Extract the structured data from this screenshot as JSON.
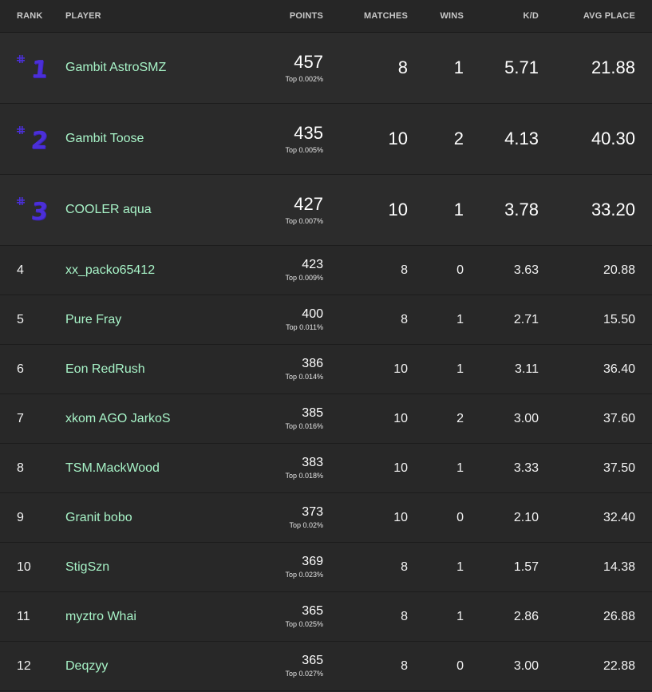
{
  "columns": {
    "rank": "RANK",
    "player": "PLAYER",
    "points": "POINTS",
    "matches": "MATCHES",
    "wins": "WINS",
    "kd": "K/D",
    "avg_place": "AVG PLACE"
  },
  "colors": {
    "player_name": "#a7f3c7",
    "rank_badge": "#4b2fd8",
    "background": "#282828"
  },
  "icons": {
    "rank_badge": "hash-icon"
  },
  "rows": [
    {
      "rank": "1",
      "player": "Gambit AstroSMZ",
      "points": "457",
      "top": "Top 0.002%",
      "matches": "8",
      "wins": "1",
      "kd": "5.71",
      "avg": "21.88"
    },
    {
      "rank": "2",
      "player": "Gambit Toose",
      "points": "435",
      "top": "Top 0.005%",
      "matches": "10",
      "wins": "2",
      "kd": "4.13",
      "avg": "40.30"
    },
    {
      "rank": "3",
      "player": "COOLER aqua",
      "points": "427",
      "top": "Top 0.007%",
      "matches": "10",
      "wins": "1",
      "kd": "3.78",
      "avg": "33.20"
    },
    {
      "rank": "4",
      "player": "xx_packo65412",
      "points": "423",
      "top": "Top 0.009%",
      "matches": "8",
      "wins": "0",
      "kd": "3.63",
      "avg": "20.88"
    },
    {
      "rank": "5",
      "player": "Pure Fray",
      "points": "400",
      "top": "Top 0.011%",
      "matches": "8",
      "wins": "1",
      "kd": "2.71",
      "avg": "15.50"
    },
    {
      "rank": "6",
      "player": "Eon RedRush",
      "points": "386",
      "top": "Top 0.014%",
      "matches": "10",
      "wins": "1",
      "kd": "3.11",
      "avg": "36.40"
    },
    {
      "rank": "7",
      "player": "xkom AGO JarkoS",
      "points": "385",
      "top": "Top 0.016%",
      "matches": "10",
      "wins": "2",
      "kd": "3.00",
      "avg": "37.60"
    },
    {
      "rank": "8",
      "player": "TSM.MackWood",
      "points": "383",
      "top": "Top 0.018%",
      "matches": "10",
      "wins": "1",
      "kd": "3.33",
      "avg": "37.50"
    },
    {
      "rank": "9",
      "player": "Granit bobo",
      "points": "373",
      "top": "Top 0.02%",
      "matches": "10",
      "wins": "0",
      "kd": "2.10",
      "avg": "32.40"
    },
    {
      "rank": "10",
      "player": "StigSzn",
      "points": "369",
      "top": "Top 0.023%",
      "matches": "8",
      "wins": "1",
      "kd": "1.57",
      "avg": "14.38"
    },
    {
      "rank": "11",
      "player": "myztro Whai",
      "points": "365",
      "top": "Top 0.025%",
      "matches": "8",
      "wins": "1",
      "kd": "2.86",
      "avg": "26.88"
    },
    {
      "rank": "12",
      "player": "Deqzyy",
      "points": "365",
      "top": "Top 0.027%",
      "matches": "8",
      "wins": "0",
      "kd": "3.00",
      "avg": "22.88"
    }
  ]
}
